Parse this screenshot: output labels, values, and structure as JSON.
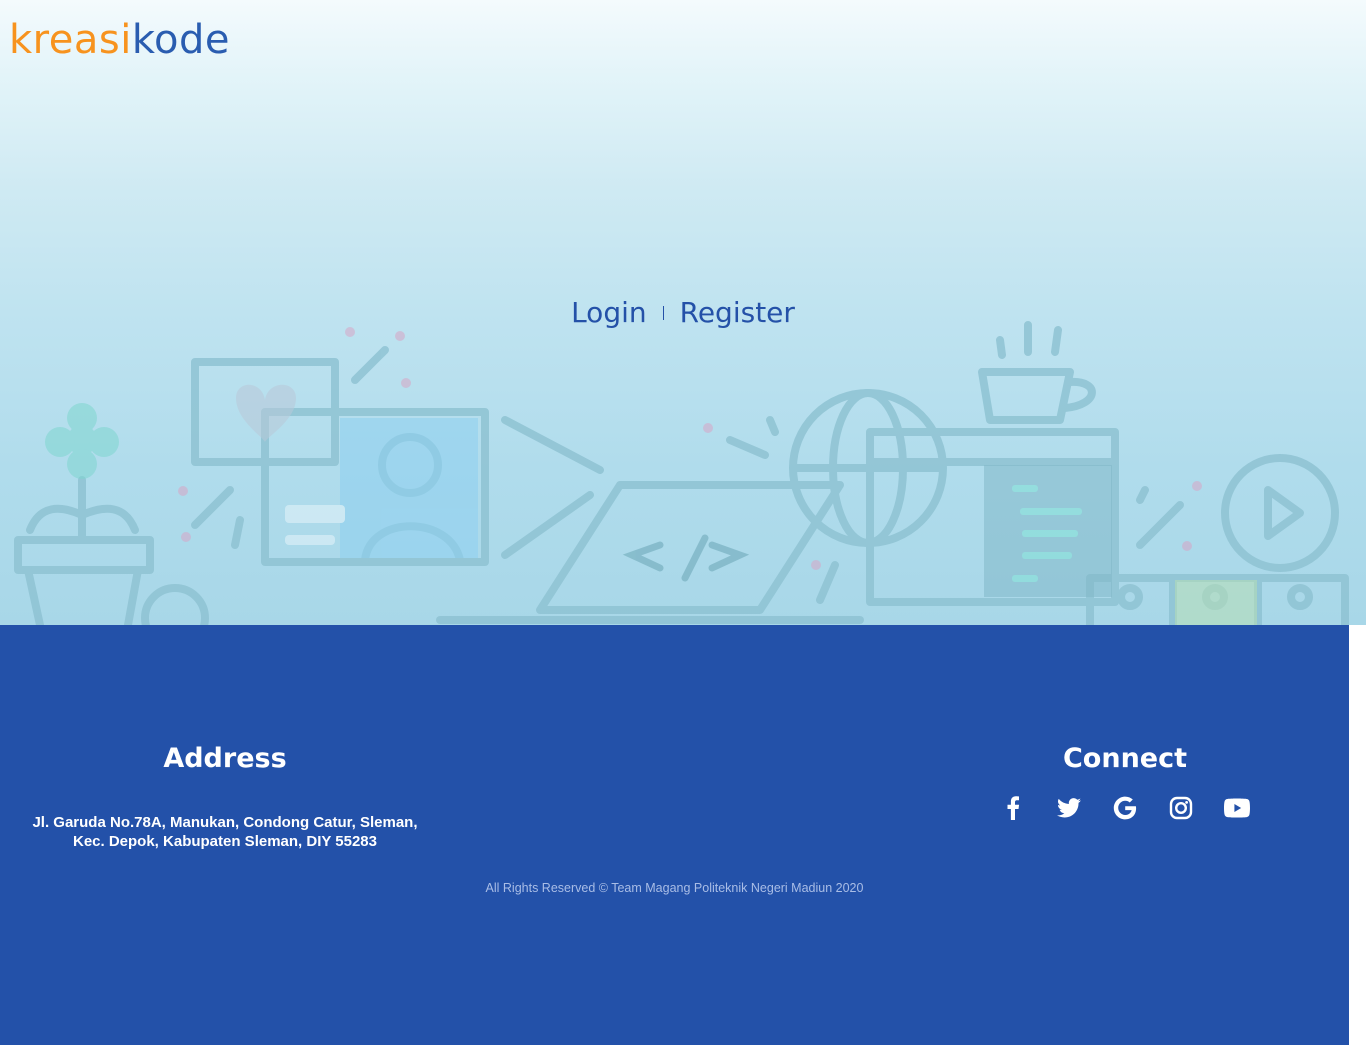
{
  "brand": {
    "part1": "kreasi",
    "part2": "kode",
    "color_primary": "#f7931e",
    "color_secondary": "#2a5db0"
  },
  "auth": {
    "login_label": "Login",
    "register_label": "Register"
  },
  "footer": {
    "background": "#2351a9",
    "address": {
      "heading": "Address",
      "line1": "Jl. Garuda No.78A, Manukan, Condong Catur, Sleman,",
      "line2": "Kec. Depok, Kabupaten Sleman, DIY 55283"
    },
    "connect": {
      "heading": "Connect",
      "icons": [
        "facebook-icon",
        "twitter-icon",
        "google-icon",
        "instagram-icon",
        "youtube-icon"
      ]
    },
    "copyright": "All Rights Reserved © Team Magang Politeknik Negeri Madiun 2020"
  }
}
